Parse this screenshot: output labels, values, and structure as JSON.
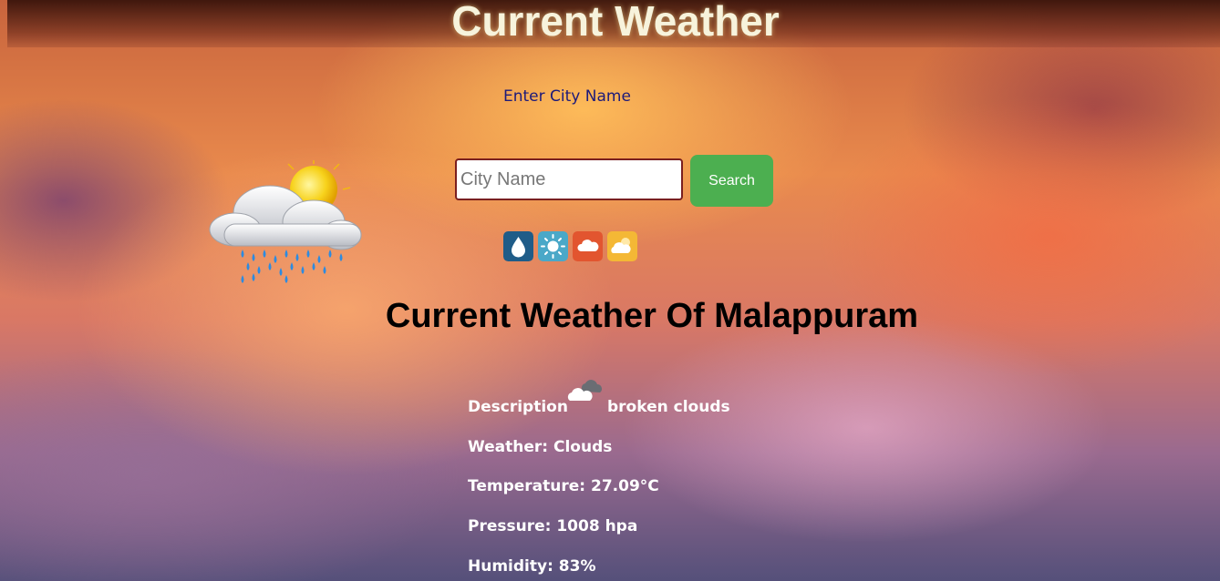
{
  "header": {
    "title": "Current Weather"
  },
  "search": {
    "label": "Enter City Name",
    "placeholder": "City Name",
    "value": "",
    "button_label": "Search"
  },
  "icons": [
    "weather-illustration-icon",
    "water-drop-icon",
    "sun-icon",
    "cloud-icon",
    "partly-cloudy-icon",
    "broken-clouds-icon"
  ],
  "result": {
    "heading": "Current Weather Of Malappuram",
    "description_label": "Description",
    "description_value": "broken clouds",
    "weather": "Weather: Clouds",
    "temperature": "Temperature: 27.09°C",
    "pressure": "Pressure: 1008 hpa",
    "humidity": "Humidity: 83%"
  },
  "colors": {
    "search_button": "#4caf50",
    "label_text": "#1d1a7a",
    "title_text": "#f7f3dc",
    "input_border": "#7a1f1f"
  }
}
